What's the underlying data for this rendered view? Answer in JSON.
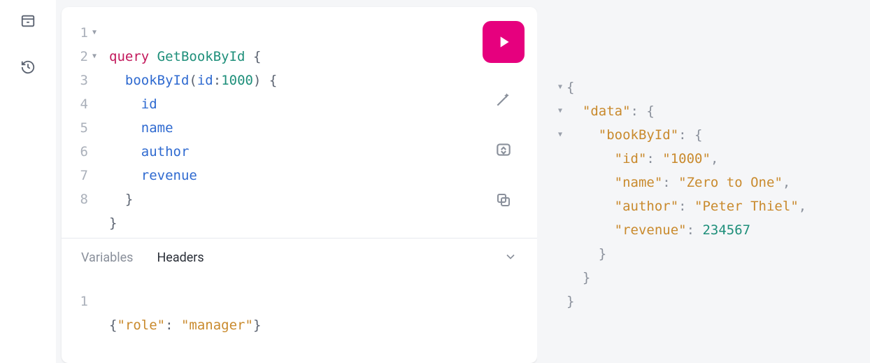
{
  "tabs": {
    "variables": "Variables",
    "headers": "Headers"
  },
  "query": {
    "lines": [
      {
        "n": "1",
        "fold": true
      },
      {
        "n": "2",
        "fold": true
      },
      {
        "n": "3",
        "fold": false
      },
      {
        "n": "4",
        "fold": false
      },
      {
        "n": "5",
        "fold": false
      },
      {
        "n": "6",
        "fold": false
      },
      {
        "n": "7",
        "fold": false
      },
      {
        "n": "8",
        "fold": false
      }
    ],
    "tokens": {
      "keyword": "query",
      "opName": "GetBookById",
      "root": "bookById",
      "argKey": "id",
      "argVal": "1000",
      "fields": [
        "id",
        "name",
        "author",
        "revenue"
      ]
    }
  },
  "headers_json": {
    "line_no": "1",
    "key": "\"role\"",
    "val": "\"manager\""
  },
  "response": {
    "dataKey": "\"data\"",
    "rootKey": "\"bookById\"",
    "fields": {
      "idK": "\"id\"",
      "idV": "\"1000\"",
      "nameK": "\"name\"",
      "nameV": "\"Zero to One\"",
      "authorK": "\"author\"",
      "authorV": "\"Peter Thiel\"",
      "revK": "\"revenue\"",
      "revV": "234567"
    }
  }
}
